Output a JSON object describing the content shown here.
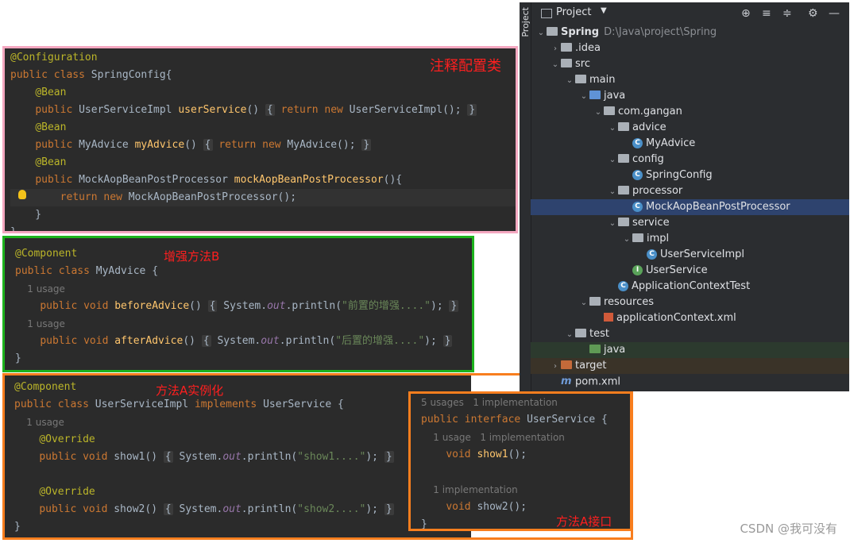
{
  "panel1": {
    "title": "注释配置类",
    "lines": [
      [
        [
          "ann",
          "@Configuration"
        ]
      ],
      [
        [
          "kw",
          "public class "
        ],
        [
          "cls",
          "SpringConfig"
        ],
        [
          "",
          "{"
        ]
      ],
      [
        [
          "",
          "    "
        ],
        [
          "ann",
          "@Bean"
        ]
      ],
      [
        [
          "",
          "    "
        ],
        [
          "kw",
          "public "
        ],
        [
          "",
          "UserServiceImpl "
        ],
        [
          "fn",
          "userService"
        ],
        [
          "",
          "() "
        ],
        [
          "brace",
          "{"
        ],
        [
          "kw",
          " return new "
        ],
        [
          "",
          "UserServiceImpl(); "
        ],
        [
          "brace",
          "}"
        ]
      ],
      [
        [
          "",
          "    "
        ],
        [
          "ann",
          "@Bean"
        ]
      ],
      [
        [
          "",
          "    "
        ],
        [
          "kw",
          "public "
        ],
        [
          "",
          "MyAdvice "
        ],
        [
          "fn",
          "myAdvice"
        ],
        [
          "",
          "() "
        ],
        [
          "brace",
          "{"
        ],
        [
          "kw",
          " return new "
        ],
        [
          "",
          "MyAdvice(); "
        ],
        [
          "brace",
          "}"
        ]
      ],
      [
        [
          "",
          "    "
        ],
        [
          "ann",
          "@Bean"
        ]
      ],
      [
        [
          "",
          "    "
        ],
        [
          "kw",
          "public "
        ],
        [
          "",
          "MockAopBeanPostProcessor "
        ],
        [
          "fn",
          "mockAopBeanPostProcessor"
        ],
        [
          "",
          "(){"
        ]
      ],
      [
        [
          "",
          "        "
        ],
        [
          "kw",
          "return new "
        ],
        [
          "",
          "MockAopBeanPostProcessor();"
        ]
      ],
      [
        [
          "",
          "    }"
        ]
      ],
      [
        [
          "",
          "}"
        ]
      ]
    ]
  },
  "panel2": {
    "title": "增强方法B",
    "lines": [
      [
        [
          "ann",
          "@Component"
        ]
      ],
      [
        [
          "kw",
          "public class "
        ],
        [
          "",
          "MyAdvice {"
        ]
      ],
      [
        [
          "hint",
          "    1 usage"
        ]
      ],
      [
        [
          "",
          "    "
        ],
        [
          "kw",
          "public void "
        ],
        [
          "fn",
          "beforeAdvice"
        ],
        [
          "",
          "() "
        ],
        [
          "brace",
          "{"
        ],
        [
          "",
          " System."
        ],
        [
          "fld",
          "out"
        ],
        [
          "",
          ".println("
        ],
        [
          "str",
          "\"前置的增强....\""
        ],
        [
          "",
          "); "
        ],
        [
          "brace",
          "}"
        ]
      ],
      [
        [
          "hint",
          "    1 usage"
        ]
      ],
      [
        [
          "",
          "    "
        ],
        [
          "kw",
          "public void "
        ],
        [
          "fn",
          "afterAdvice"
        ],
        [
          "",
          "() "
        ],
        [
          "brace",
          "{"
        ],
        [
          "",
          " System."
        ],
        [
          "fld",
          "out"
        ],
        [
          "",
          ".println("
        ],
        [
          "str",
          "\"后置的增强....\""
        ],
        [
          "",
          "); "
        ],
        [
          "brace",
          "}"
        ]
      ],
      [
        [
          "",
          "}"
        ]
      ]
    ]
  },
  "panel3": {
    "title": "方法A实例化",
    "lines": [
      [
        [
          "ann",
          "@Component"
        ]
      ],
      [
        [
          "kw",
          "public class "
        ],
        [
          "",
          "UserServiceImpl "
        ],
        [
          "kw",
          "implements "
        ],
        [
          "",
          "UserService {"
        ]
      ],
      [
        [
          "hint",
          "    1 usage"
        ]
      ],
      [
        [
          "",
          "    "
        ],
        [
          "ann",
          "@Override"
        ]
      ],
      [
        [
          "",
          "    "
        ],
        [
          "kw",
          "public void "
        ],
        [
          "",
          "show1() "
        ],
        [
          "brace",
          "{"
        ],
        [
          "",
          " System."
        ],
        [
          "fld",
          "out"
        ],
        [
          "",
          ".println("
        ],
        [
          "str",
          "\"show1....\""
        ],
        [
          "",
          "); "
        ],
        [
          "brace",
          "}"
        ]
      ],
      [
        [
          "",
          ""
        ]
      ],
      [
        [
          "",
          "    "
        ],
        [
          "ann",
          "@Override"
        ]
      ],
      [
        [
          "",
          "    "
        ],
        [
          "kw",
          "public void "
        ],
        [
          "",
          "show2() "
        ],
        [
          "brace",
          "{"
        ],
        [
          "",
          " System."
        ],
        [
          "fld",
          "out"
        ],
        [
          "",
          ".println("
        ],
        [
          "str",
          "\"show2....\""
        ],
        [
          "",
          "); "
        ],
        [
          "brace",
          "}"
        ]
      ],
      [
        [
          "",
          "}"
        ]
      ]
    ]
  },
  "panel4": {
    "title": "方法A接口",
    "lines": [
      [
        [
          "hint",
          "5 usages   1 implementation"
        ]
      ],
      [
        [
          "kw",
          "public interface "
        ],
        [
          "",
          "UserService {"
        ]
      ],
      [
        [
          "hint",
          "    1 usage   1 implementation"
        ]
      ],
      [
        [
          "",
          "    "
        ],
        [
          "kw",
          "void "
        ],
        [
          "fn",
          "show1"
        ],
        [
          "",
          "();"
        ]
      ],
      [
        [
          "",
          ""
        ]
      ],
      [
        [
          "hint",
          "    1 implementation"
        ]
      ],
      [
        [
          "",
          "    "
        ],
        [
          "kw",
          "void "
        ],
        [
          "",
          "show2();"
        ]
      ],
      [
        [
          "",
          "}"
        ]
      ]
    ]
  },
  "project": {
    "stripe_label": "Project",
    "title": "Project",
    "root_name": "Spring",
    "root_path": "D:\\Java\\project\\Spring",
    "items": [
      {
        "label": ".idea",
        "indent": 1,
        "arrow": "›",
        "icon": "folder"
      },
      {
        "label": "src",
        "indent": 1,
        "arrow": "⌄",
        "icon": "folder"
      },
      {
        "label": "main",
        "indent": 2,
        "arrow": "⌄",
        "icon": "folder"
      },
      {
        "label": "java",
        "indent": 3,
        "arrow": "⌄",
        "icon": "folder-blue"
      },
      {
        "label": "com.gangan",
        "indent": 4,
        "arrow": "⌄",
        "icon": "folder"
      },
      {
        "label": "advice",
        "indent": 5,
        "arrow": "⌄",
        "icon": "folder"
      },
      {
        "label": "MyAdvice",
        "indent": 6,
        "arrow": "",
        "icon": "class"
      },
      {
        "label": "config",
        "indent": 5,
        "arrow": "⌄",
        "icon": "folder"
      },
      {
        "label": "SpringConfig",
        "indent": 6,
        "arrow": "",
        "icon": "class"
      },
      {
        "label": "processor",
        "indent": 5,
        "arrow": "⌄",
        "icon": "folder"
      },
      {
        "label": "MockAopBeanPostProcessor",
        "indent": 6,
        "arrow": "",
        "icon": "class",
        "selected": true
      },
      {
        "label": "service",
        "indent": 5,
        "arrow": "⌄",
        "icon": "folder"
      },
      {
        "label": "impl",
        "indent": 6,
        "arrow": "⌄",
        "icon": "folder"
      },
      {
        "label": "UserServiceImpl",
        "indent": 7,
        "arrow": "",
        "icon": "class"
      },
      {
        "label": "UserService",
        "indent": 6,
        "arrow": "",
        "icon": "interface"
      },
      {
        "label": "ApplicationContextTest",
        "indent": 5,
        "arrow": "",
        "icon": "class"
      },
      {
        "label": "resources",
        "indent": 3,
        "arrow": "⌄",
        "icon": "folder"
      },
      {
        "label": "applicationContext.xml",
        "indent": 4,
        "arrow": "",
        "icon": "xml"
      },
      {
        "label": "test",
        "indent": 2,
        "arrow": "⌄",
        "icon": "folder"
      },
      {
        "label": "java",
        "indent": 3,
        "arrow": "",
        "icon": "folder-green",
        "highlight": "sel2"
      },
      {
        "label": "target",
        "indent": 1,
        "arrow": "›",
        "icon": "folder-orange",
        "highlight": "sel3"
      },
      {
        "label": "pom.xml",
        "indent": 1,
        "arrow": "",
        "icon": "maven"
      }
    ]
  },
  "watermark": "CSDN @我可没有",
  "colors": {
    "pink_border": "#f4a7c0",
    "green_border": "#1db31d",
    "orange_border": "#f87e1e",
    "red_text": "#ff1f1f"
  }
}
